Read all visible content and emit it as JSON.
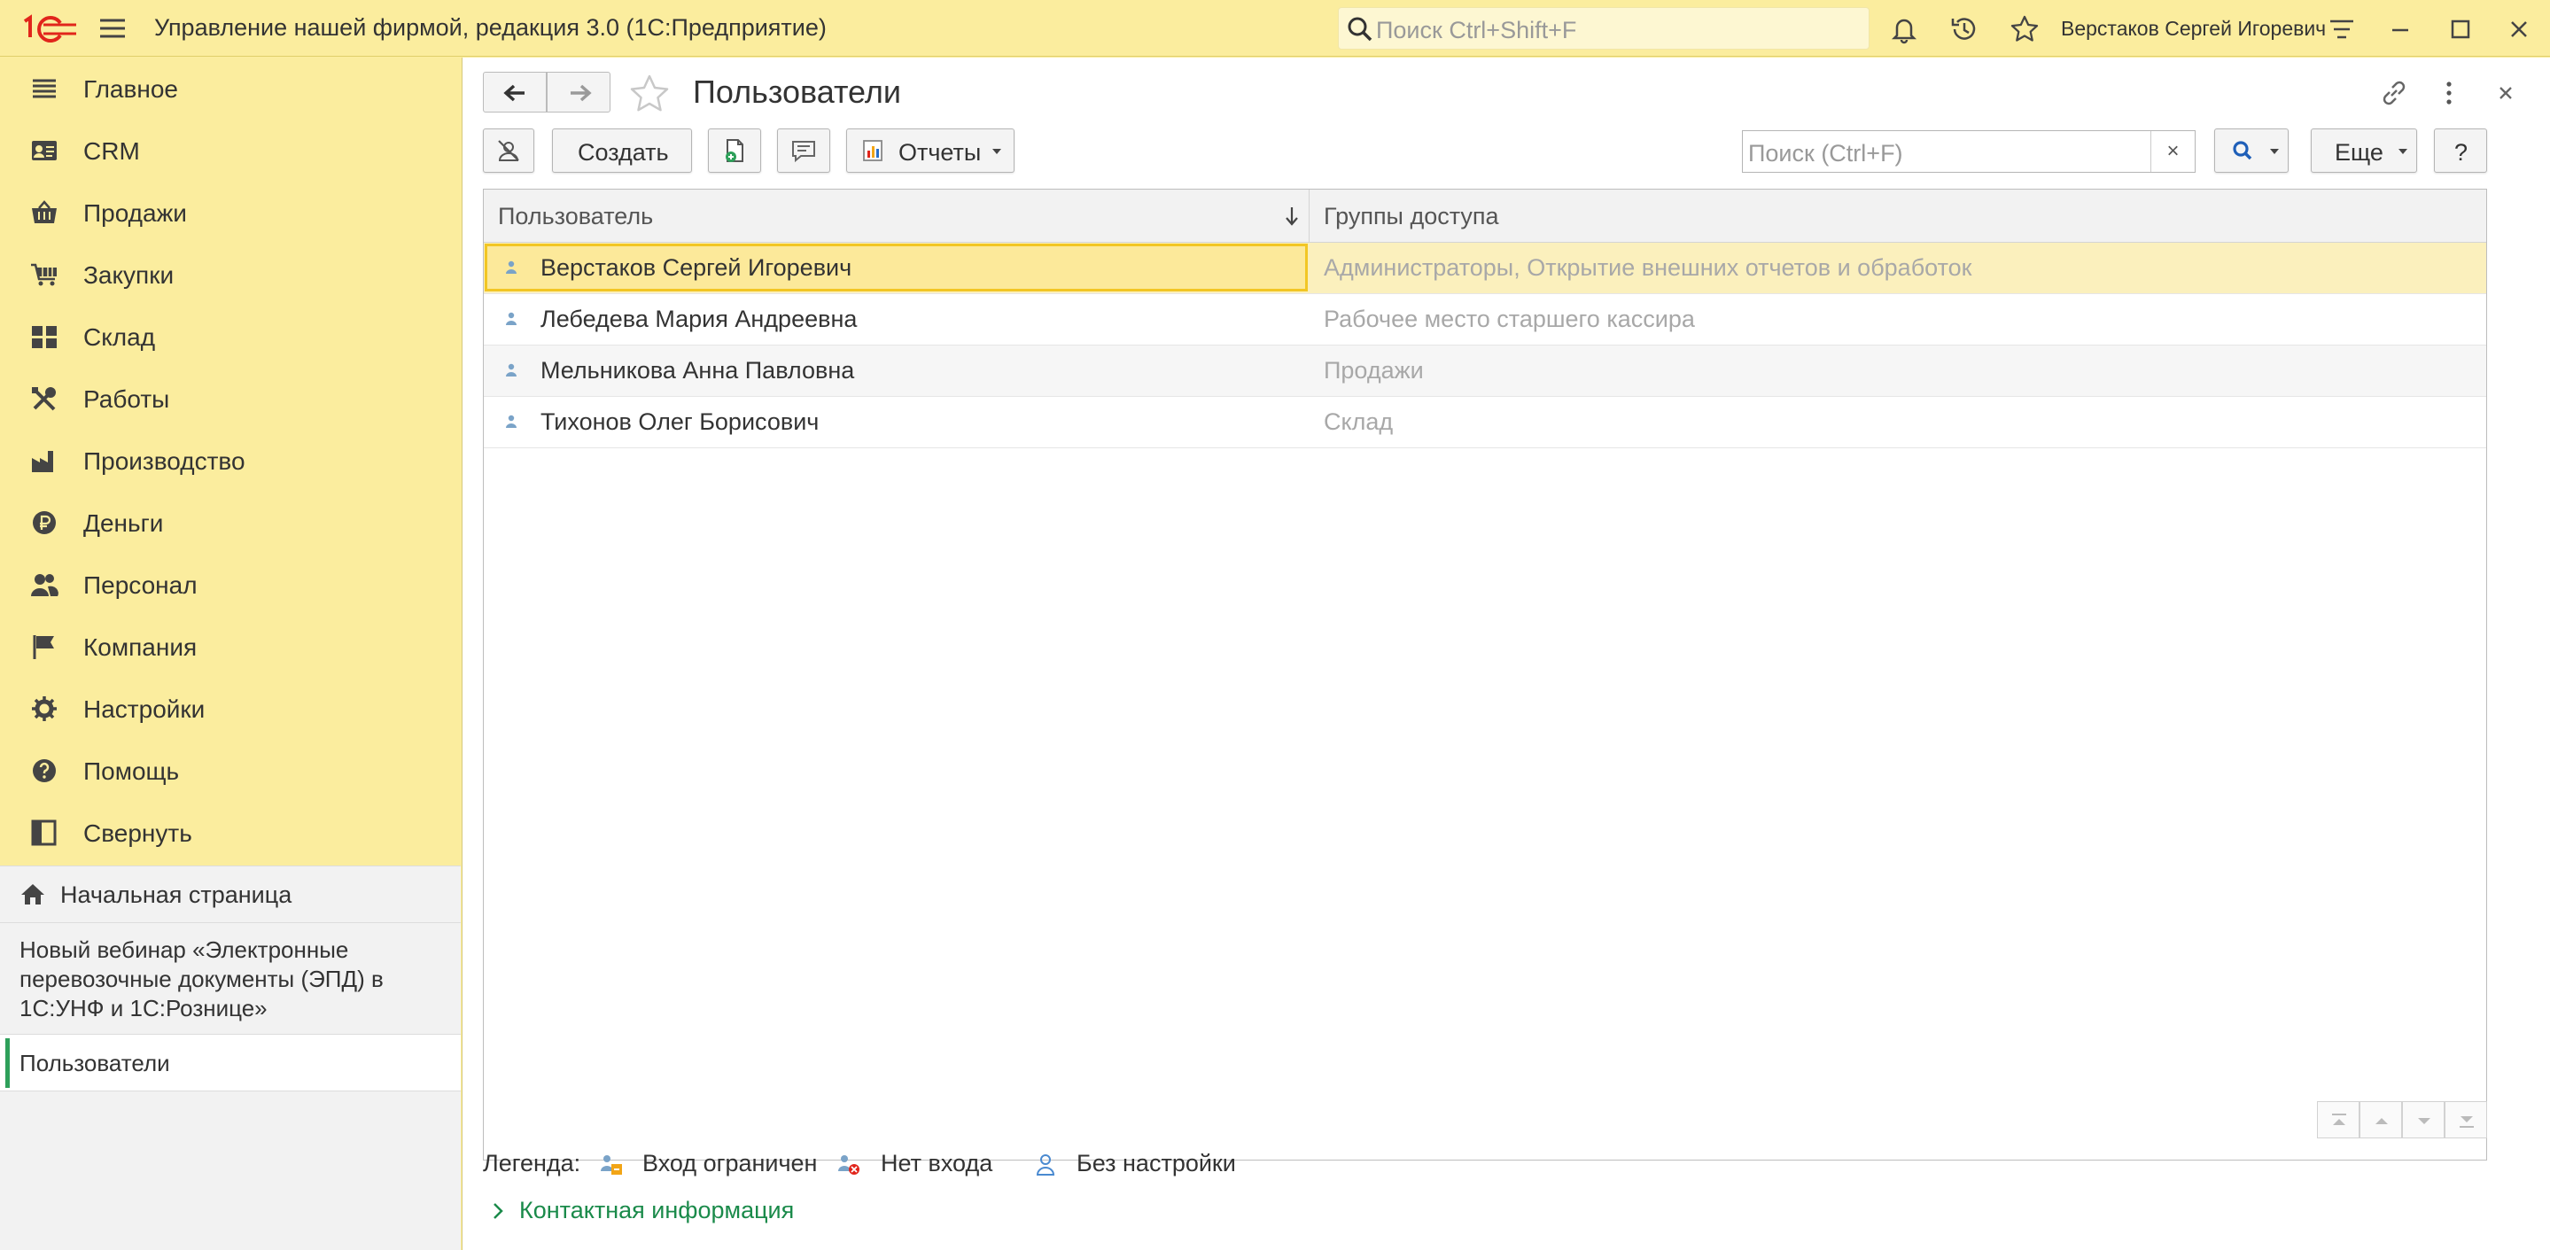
{
  "window": {
    "title": "Управление нашей фирмой, редакция 3.0  (1С:Предприятие)",
    "search_placeholder": "Поиск Ctrl+Shift+F",
    "user_name": "Верстаков Сергей Игоревич"
  },
  "sidebar": {
    "items": [
      {
        "label": "Главное",
        "icon": "menu-list-icon"
      },
      {
        "label": "CRM",
        "icon": "contacts-card-icon"
      },
      {
        "label": "Продажи",
        "icon": "basket-icon"
      },
      {
        "label": "Закупки",
        "icon": "cart-icon"
      },
      {
        "label": "Склад",
        "icon": "warehouse-grid-icon"
      },
      {
        "label": "Работы",
        "icon": "tools-icon"
      },
      {
        "label": "Производство",
        "icon": "factory-icon"
      },
      {
        "label": "Деньги",
        "icon": "ruble-coin-icon"
      },
      {
        "label": "Персонал",
        "icon": "people-icon"
      },
      {
        "label": "Компания",
        "icon": "flag-icon"
      },
      {
        "label": "Настройки",
        "icon": "gear-icon"
      },
      {
        "label": "Помощь",
        "icon": "help-icon"
      },
      {
        "label": "Свернуть",
        "icon": "collapse-panel-icon"
      }
    ],
    "home_label": "Начальная страница",
    "news_text": "Новый вебинар «Электронные перевозочные документы (ЭПД) в 1С:УНФ и 1С:Рознице»",
    "open_window": "Пользователи"
  },
  "form": {
    "title": "Пользователи",
    "buttons": {
      "create": "Создать",
      "reports": "Отчеты",
      "more": "Еще",
      "help": "?"
    },
    "search_placeholder": "Поиск (Ctrl+F)",
    "search_clear": "×",
    "columns": {
      "user": "Пользователь",
      "groups": "Группы доступа"
    },
    "rows": [
      {
        "name": "Верстаков Сергей Игоревич",
        "groups": "Администраторы, Открытие внешних отчетов и обработок"
      },
      {
        "name": "Лебедева Мария Андреевна",
        "groups": "Рабочее место старшего кассира"
      },
      {
        "name": "Мельникова Анна Павловна",
        "groups": "Продажи"
      },
      {
        "name": "Тихонов Олег Борисович",
        "groups": "Склад"
      }
    ],
    "legend": {
      "title": "Легенда:",
      "items": [
        "Вход ограничен",
        "Нет входа",
        "Без настройки"
      ]
    },
    "contact_info": "Контактная информация"
  },
  "colors": {
    "accent_yellow": "#fbed9e",
    "selection": "#f2c624",
    "link_green": "#1a8a4a",
    "brand_red": "#e1251b"
  }
}
